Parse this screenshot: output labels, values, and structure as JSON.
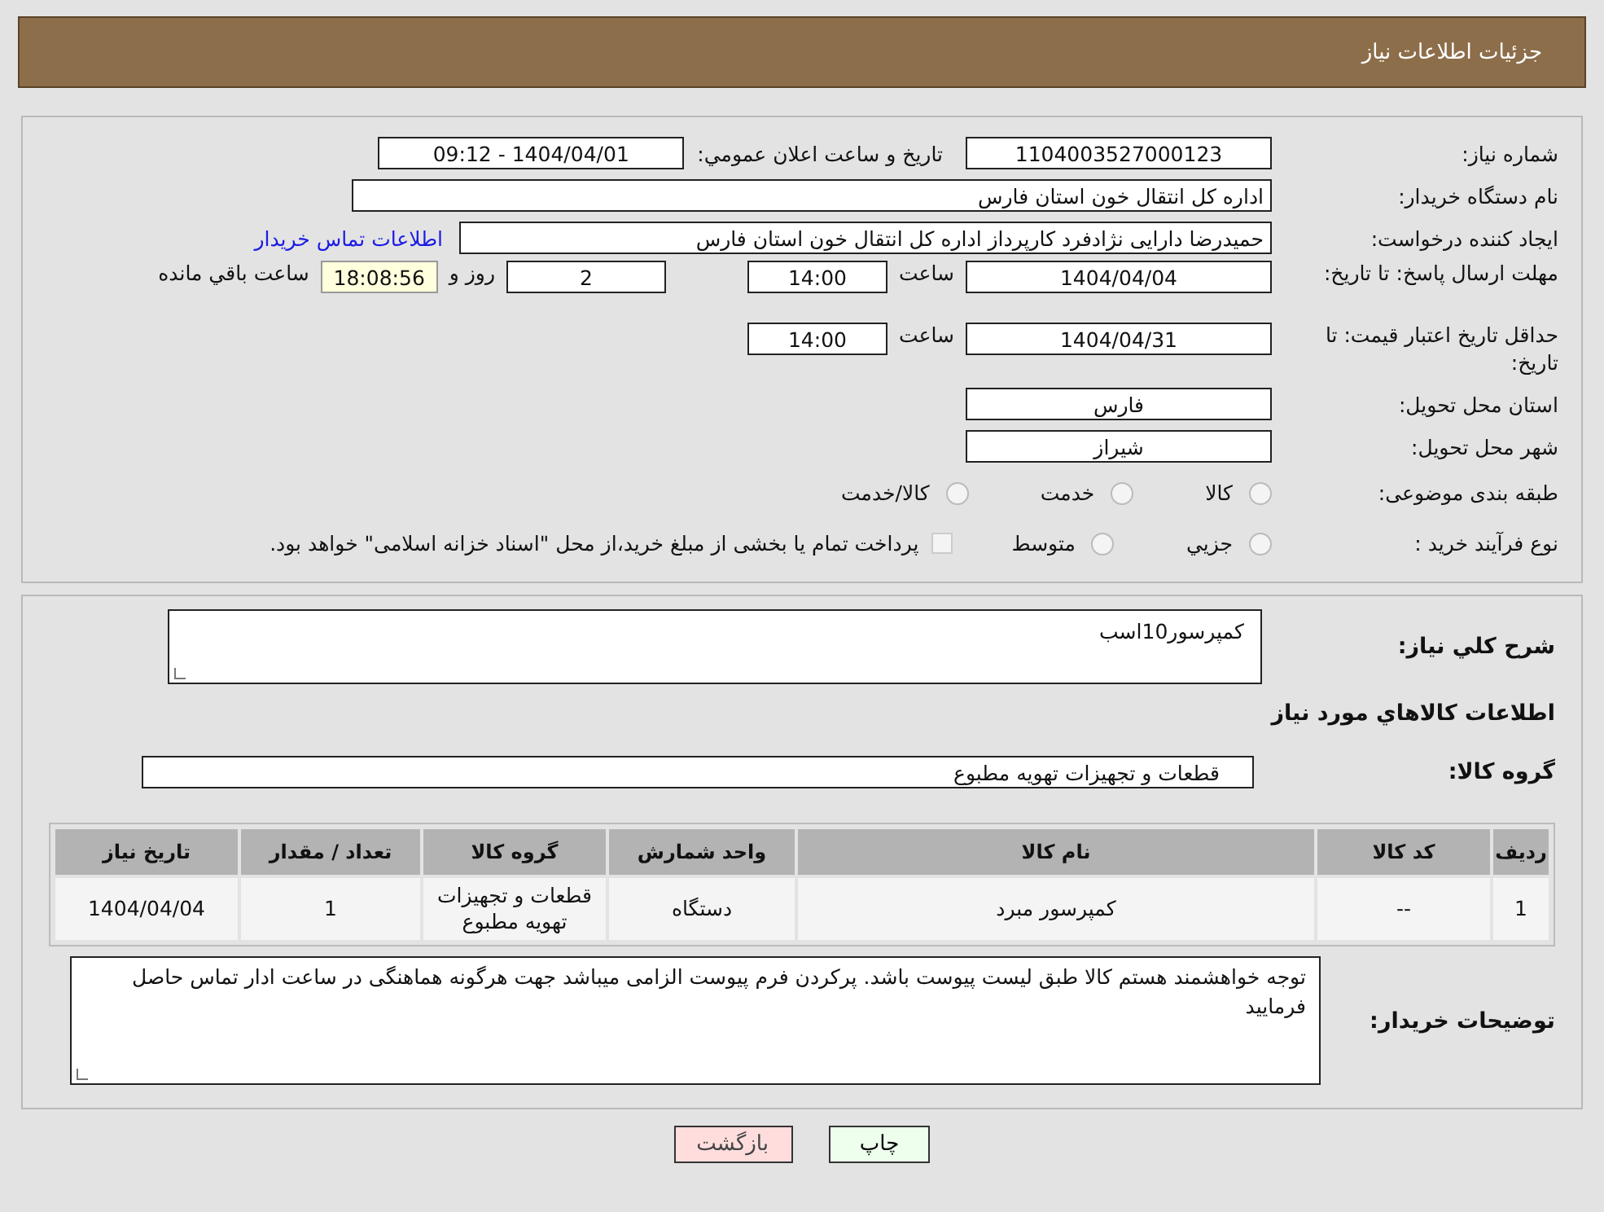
{
  "header": {
    "title": "جزئیات اطلاعات نیاز"
  },
  "need_number": {
    "label": "شماره نیاز:",
    "value": "1104003527000123"
  },
  "announce": {
    "label": "تاریخ و ساعت اعلان عمومي:",
    "value": "1404/04/01 - 09:12"
  },
  "buyer_org": {
    "label": "نام دستگاه خریدار:",
    "value": "اداره کل انتقال خون استان فارس"
  },
  "requester": {
    "label": "ایجاد کننده درخواست:",
    "value": "حمیدرضا دارایی نژادفرد کارپرداز اداره کل انتقال خون استان فارس",
    "link": "اطلاعات تماس خریدار"
  },
  "deadline": {
    "label": "مهلت ارسال پاسخ: تا تاریخ:",
    "date": "1404/04/04",
    "time_label": "ساعت",
    "time": "14:00",
    "days": "2",
    "days_label": "روز و",
    "remaining": "18:08:56",
    "remaining_label": "ساعت باقي مانده"
  },
  "price_validity": {
    "label": "حداقل تاریخ اعتبار قیمت: تا تاریخ:",
    "date": "1404/04/31",
    "time_label": "ساعت",
    "time": "14:00"
  },
  "province": {
    "label": "استان محل تحویل:",
    "value": "فارس"
  },
  "city": {
    "label": "شهر محل تحویل:",
    "value": "شیراز"
  },
  "category": {
    "label": "طبقه بندی موضوعی:",
    "options": [
      {
        "label": "کالا",
        "selected": false
      },
      {
        "label": "خدمت",
        "selected": false
      },
      {
        "label": "کالا/خدمت",
        "selected": false
      }
    ]
  },
  "purchase_type": {
    "label": "نوع فرآیند خرید :",
    "options": [
      {
        "label": "جزیي",
        "selected": false
      },
      {
        "label": "متوسط",
        "selected": false
      }
    ],
    "note_checked": false,
    "note": "پرداخت تمام یا بخشی از مبلغ خرید،از محل \"اسناد خزانه اسلامی\" خواهد بود."
  },
  "description": {
    "label": "شرح کلي نیاز:",
    "value": "کمپرسور10اسب"
  },
  "items_title": "اطلاعات کالاهاي مورد نیاز",
  "goods_group": {
    "label": "گروه کالا:",
    "value": "قطعات و تجهیزات تهویه مطبوع"
  },
  "table": {
    "columns": [
      "ردیف",
      "کد کالا",
      "نام کالا",
      "واحد شمارش",
      "گروه کالا",
      "تعداد / مقدار",
      "تاریخ نیاز"
    ],
    "rows": [
      [
        "1",
        "--",
        "کمپرسور مبرد",
        "دستگاه",
        "قطعات و تجهیزات تهویه مطبوع",
        "1",
        "1404/04/04"
      ]
    ]
  },
  "buyer_notes": {
    "label": "توضیحات خریدار:",
    "value": "توجه خواهشمند هستم کالا طبق لیست پیوست باشد. پرکردن فرم پیوست الزامی میباشد جهت هرگونه هماهنگی در ساعت ادار تماس حاصل فرمایید"
  },
  "buttons": [
    {
      "kind": "print",
      "label": "چاپ"
    },
    {
      "kind": "back",
      "label": "بازگشت"
    }
  ]
}
